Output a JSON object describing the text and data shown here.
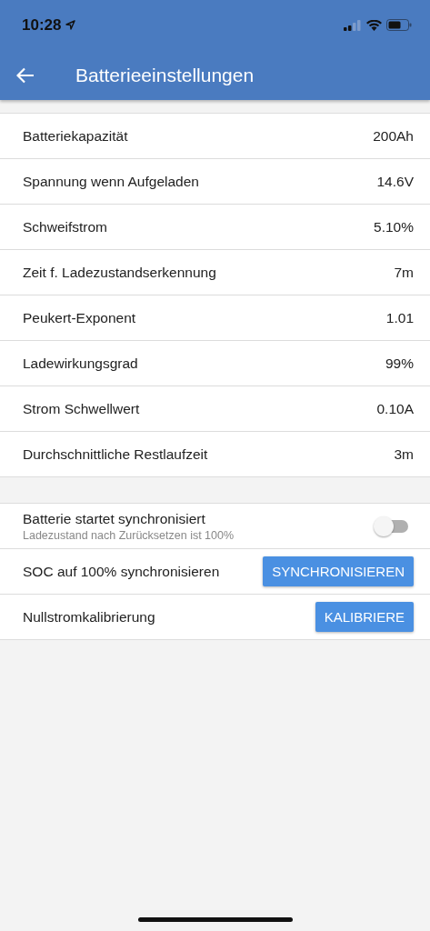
{
  "status_bar": {
    "time": "10:28"
  },
  "header": {
    "title": "Batterieeinstellungen"
  },
  "settings": [
    {
      "label": "Batteriekapazität",
      "value": "200Ah"
    },
    {
      "label": "Spannung wenn Aufgeladen",
      "value": "14.6V"
    },
    {
      "label": "Schweifstrom",
      "value": "5.10%"
    },
    {
      "label": "Zeit f. Ladezustandserkennung",
      "value": "7m"
    },
    {
      "label": "Peukert-Exponent",
      "value": "1.01"
    },
    {
      "label": "Ladewirkungsgrad",
      "value": "99%"
    },
    {
      "label": "Strom Schwellwert",
      "value": "0.10A"
    },
    {
      "label": "Durchschnittliche Restlaufzeit",
      "value": "3m"
    }
  ],
  "actions": [
    {
      "kind": "toggle",
      "label": "Batterie startet synchronisiert",
      "sublabel": "Ladezustand nach Zurücksetzen ist 100%",
      "on": false
    },
    {
      "kind": "button",
      "label": "SOC auf 100% synchronisieren",
      "button": "SYNCHRONISIEREN"
    },
    {
      "kind": "button",
      "label": "Nullstromkalibrierung",
      "button": "KALIBRIERE"
    }
  ]
}
